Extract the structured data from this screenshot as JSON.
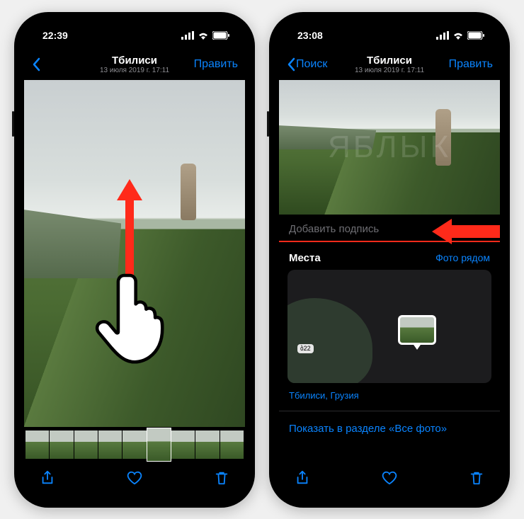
{
  "watermark": "ЯБЛЫК",
  "left": {
    "status": {
      "time": "22:39"
    },
    "nav": {
      "back_label": "",
      "title": "Тбилиси",
      "subtitle": "13 июля 2019 г. 17:11",
      "edit": "Править"
    },
    "toolbar": {
      "share_icon": "share-icon",
      "heart_icon": "heart-icon",
      "trash_icon": "trash-icon"
    }
  },
  "right": {
    "status": {
      "time": "23:08"
    },
    "nav": {
      "back_label": "Поиск",
      "title": "Тбилиси",
      "subtitle": "13 июля 2019 г. 17:11",
      "edit": "Править"
    },
    "caption_placeholder": "Добавить подпись",
    "places": {
      "heading": "Места",
      "link": "Фото рядом",
      "road_label": "ბ22",
      "location": "Тбилиси, Грузия"
    },
    "show_all": "Показать в разделе «Все фото»",
    "toolbar": {
      "share_icon": "share-icon",
      "heart_icon": "heart-icon",
      "trash_icon": "trash-icon"
    }
  }
}
